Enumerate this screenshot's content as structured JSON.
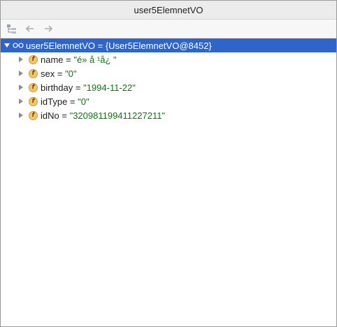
{
  "window": {
    "title": "user5ElemnetVO"
  },
  "toolbar": {
    "items": [
      "tree-view-icon",
      "back-arrow-icon",
      "forward-arrow-icon"
    ]
  },
  "tree": {
    "root": {
      "name": "user5ElemnetVO",
      "eq": " = ",
      "value": "{User5ElemnetVO@8452}"
    },
    "fields": [
      {
        "name": "name",
        "eq": " = ",
        "value": "\"é»  å  ¹å¿  \""
      },
      {
        "name": "sex",
        "eq": " = ",
        "value": "\"0\""
      },
      {
        "name": "birthday",
        "eq": " = ",
        "value": "\"1994-11-22\""
      },
      {
        "name": "idType",
        "eq": " = ",
        "value": "\"0\""
      },
      {
        "name": "idNo",
        "eq": " = ",
        "value": "\"320981199411227211\""
      }
    ]
  },
  "colors": {
    "selection": "#2f65ca",
    "string_value": "#0b7a0b",
    "field_badge": "#f4c66b"
  }
}
